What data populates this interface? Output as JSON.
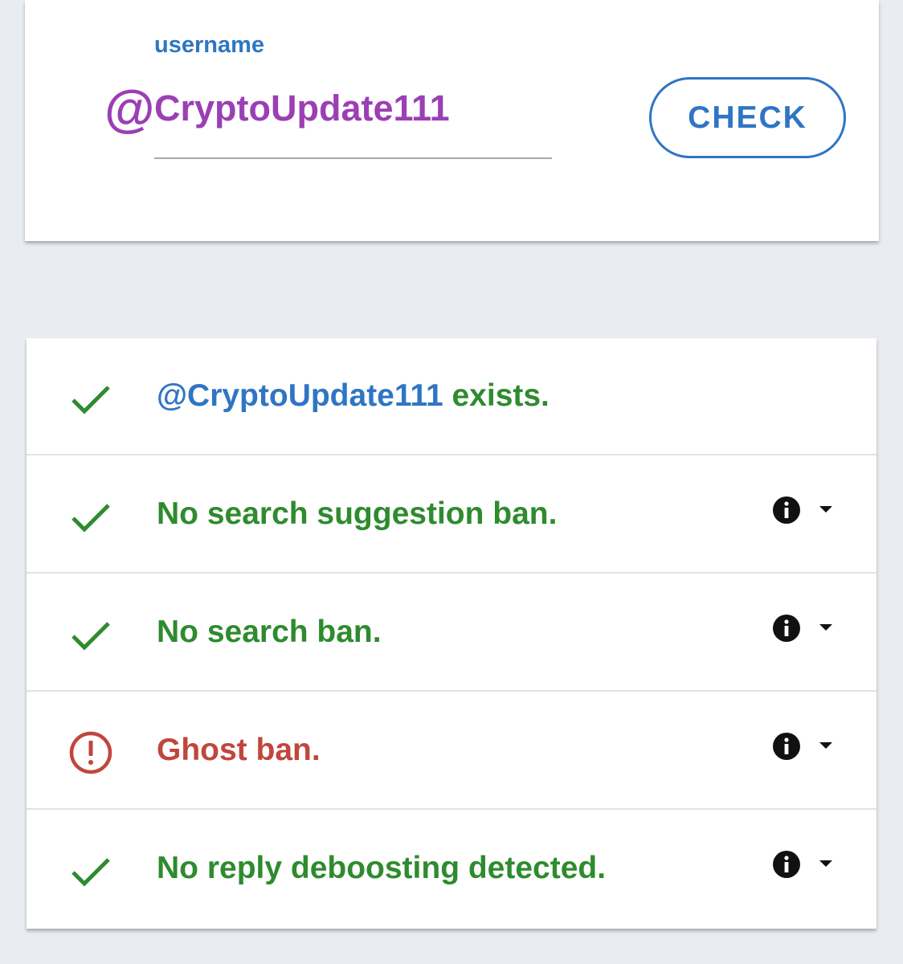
{
  "colors": {
    "background": "#e9edf1",
    "accent_blue": "#2f75c3",
    "handle_purple": "#9b3fb4",
    "success_green": "#2e8b2e",
    "error_red": "#c0463d",
    "info_black": "#111111"
  },
  "search": {
    "at_symbol": "@",
    "label": "username",
    "value": "CryptoUpdate111",
    "check_button_label": "CHECK"
  },
  "results": [
    {
      "status": "ok",
      "icon": "check-icon",
      "handle": "@CryptoUpdate111",
      "text": " exists.",
      "has_details": false
    },
    {
      "status": "ok",
      "icon": "check-icon",
      "text": "No search suggestion ban.",
      "has_details": true,
      "details_icon": "info-icon",
      "toggle_icon": "caret-down-icon"
    },
    {
      "status": "ok",
      "icon": "check-icon",
      "text": "No search ban.",
      "has_details": true,
      "details_icon": "info-icon",
      "toggle_icon": "caret-down-icon"
    },
    {
      "status": "error",
      "icon": "alert-circle-icon",
      "text": "Ghost ban.",
      "has_details": true,
      "details_icon": "info-icon",
      "toggle_icon": "caret-down-icon"
    },
    {
      "status": "ok",
      "icon": "check-icon",
      "text": "No reply deboosting detected.",
      "has_details": true,
      "details_icon": "info-icon",
      "toggle_icon": "caret-down-icon"
    }
  ]
}
